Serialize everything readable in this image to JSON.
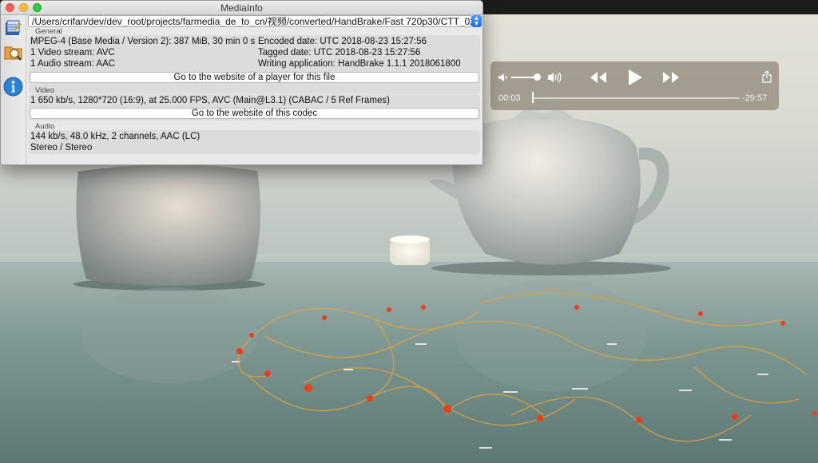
{
  "window": {
    "title": "MediaInfo",
    "file_path": "/Users/crifan/dev/dev_root/projects/farmedia_de_to_cn/视频/converted/HandBrake/Fast 720p30/CTT_02_17_CH_..."
  },
  "toolbar": {
    "icons": [
      "open-file-icon",
      "open-folder-icon",
      "info-icon"
    ]
  },
  "general": {
    "label": "General",
    "line1_left": "MPEG-4 (Base Media / Version 2): 387 MiB, 30 min 0 s",
    "line2_left": "1 Video stream: AVC",
    "line3_left": "1 Audio stream: AAC",
    "line1_right": "Encoded date: UTC 2018-08-23 15:27:56",
    "line2_right": "Tagged date: UTC 2018-08-23 15:27:56",
    "line3_right": "Writing application: HandBrake 1.1.1 2018061800",
    "button": "Go to the website of a player for this file"
  },
  "video": {
    "label": "Video",
    "line1": "1 650 kb/s, 1280*720 (16:9), at 25.000 FPS, AVC (Main@L3.1) (CABAC / 5 Ref Frames)",
    "button": "Go to the website of this codec"
  },
  "audio": {
    "label": "Audio",
    "line1": "144 kb/s, 48.0 kHz, 2 channels, AAC (LC)",
    "line2": "Stereo / Stereo"
  },
  "player": {
    "current_time": "00:03",
    "remaining_time": "-29:57",
    "volume_level": 0.9,
    "progress_fraction": 0.0017
  },
  "colors": {
    "close": "#fc605c",
    "minimize": "#fdbc40",
    "maximize": "#34c84a",
    "stepper": "#1a6cf0"
  }
}
